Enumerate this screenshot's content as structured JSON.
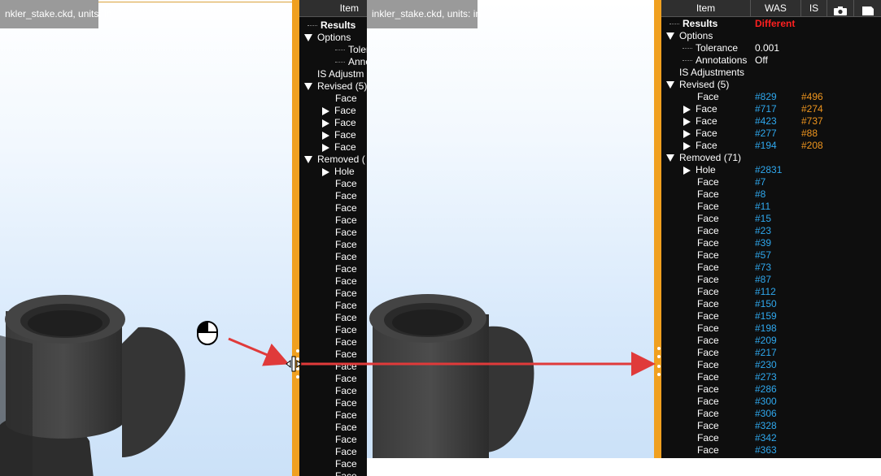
{
  "left_view": {
    "title": "nkler_stake.ckd, units: in",
    "tree_header": "Item",
    "rows": [
      {
        "label": "Results",
        "bold": true,
        "prefix": "dots"
      },
      {
        "label": "Options",
        "prefix": "down"
      },
      {
        "label": "Toleran",
        "prefix": "dots",
        "indent": 2
      },
      {
        "label": "Annota",
        "prefix": "dots",
        "indent": 2
      },
      {
        "label": "IS Adjustm",
        "prefix": "none",
        "indent": 0
      },
      {
        "label": "Revised (5)",
        "prefix": "down"
      },
      {
        "label": "Face",
        "prefix": "none",
        "indent": 2
      },
      {
        "label": "Face",
        "prefix": "right",
        "indent": 1
      },
      {
        "label": "Face",
        "prefix": "right",
        "indent": 1
      },
      {
        "label": "Face",
        "prefix": "right",
        "indent": 1
      },
      {
        "label": "Face",
        "prefix": "right",
        "indent": 1
      },
      {
        "label": "Removed (",
        "prefix": "down"
      },
      {
        "label": "Hole",
        "prefix": "right",
        "indent": 1
      }
    ],
    "face_label": "Face",
    "face_rows_count": 25
  },
  "right_view": {
    "title": "inkler_stake.ckd, units: in",
    "headers": {
      "item": "Item",
      "was": "WAS",
      "is": "IS"
    },
    "results_label": "Results",
    "results_value": "Different",
    "options_label": "Options",
    "tolerance_label": "Tolerance",
    "tolerance_value": "0.001",
    "annotations_label": "Annotations",
    "annotations_value": "Off",
    "is_adjustments_label": "IS Adjustments",
    "revised_label": "Revised (5)",
    "revised": [
      {
        "label": "Face",
        "was": "#829",
        "is": "#496",
        "expand": false
      },
      {
        "label": "Face",
        "was": "#717",
        "is": "#274",
        "expand": true
      },
      {
        "label": "Face",
        "was": "#423",
        "is": "#737",
        "expand": true
      },
      {
        "label": "Face",
        "was": "#277",
        "is": "#88",
        "expand": true
      },
      {
        "label": "Face",
        "was": "#194",
        "is": "#208",
        "expand": true
      }
    ],
    "removed_label": "Removed (71)",
    "removed": [
      {
        "label": "Hole",
        "was": "#2831",
        "expand": true
      },
      {
        "label": "Face",
        "was": "#7"
      },
      {
        "label": "Face",
        "was": "#8"
      },
      {
        "label": "Face",
        "was": "#11"
      },
      {
        "label": "Face",
        "was": "#15"
      },
      {
        "label": "Face",
        "was": "#23"
      },
      {
        "label": "Face",
        "was": "#39"
      },
      {
        "label": "Face",
        "was": "#57"
      },
      {
        "label": "Face",
        "was": "#73"
      },
      {
        "label": "Face",
        "was": "#87"
      },
      {
        "label": "Face",
        "was": "#112"
      },
      {
        "label": "Face",
        "was": "#150"
      },
      {
        "label": "Face",
        "was": "#159"
      },
      {
        "label": "Face",
        "was": "#198"
      },
      {
        "label": "Face",
        "was": "#209"
      },
      {
        "label": "Face",
        "was": "#217"
      },
      {
        "label": "Face",
        "was": "#230"
      },
      {
        "label": "Face",
        "was": "#273"
      },
      {
        "label": "Face",
        "was": "#286"
      },
      {
        "label": "Face",
        "was": "#300"
      },
      {
        "label": "Face",
        "was": "#306"
      },
      {
        "label": "Face",
        "was": "#328"
      },
      {
        "label": "Face",
        "was": "#342"
      },
      {
        "label": "Face",
        "was": "#363"
      }
    ]
  },
  "colors": {
    "was": "#2fa8ee",
    "is": "#f0961e",
    "different": "#ff2020",
    "border": "#f0a020",
    "arrow": "#e03a3a"
  },
  "icons": [
    "mouse-icon",
    "camera-icon",
    "flag-icon",
    "resize-cursor-icon",
    "expand-arrow-icon",
    "collapse-arrow-icon"
  ]
}
